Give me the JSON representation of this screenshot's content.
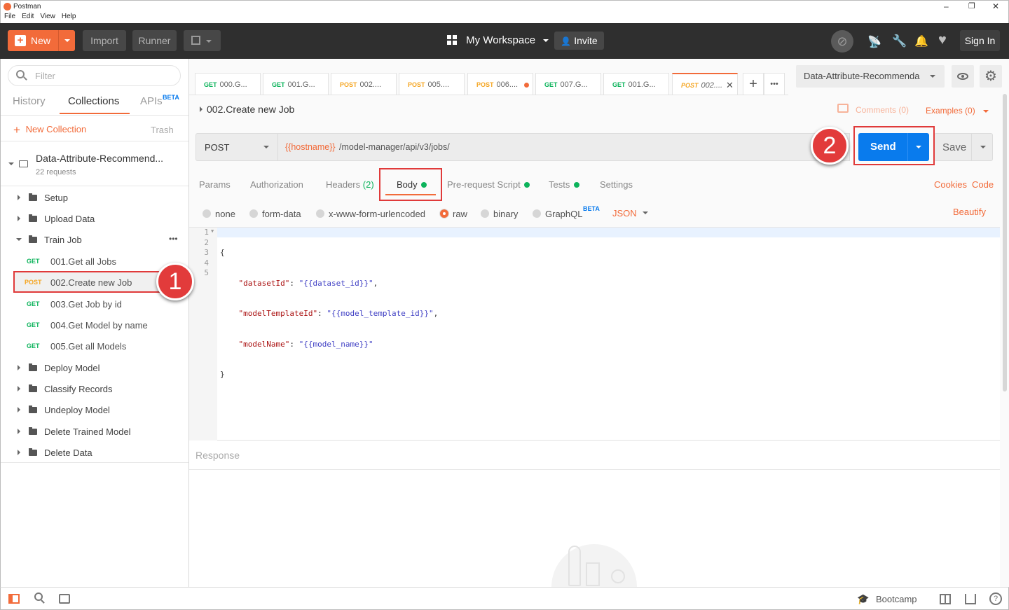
{
  "window": {
    "title": "Postman",
    "minimize": "–",
    "restore": "❐",
    "close": "✕"
  },
  "menu": [
    "File",
    "Edit",
    "View",
    "Help"
  ],
  "header": {
    "new_label": "New",
    "import_label": "Import",
    "runner_label": "Runner",
    "workspace_label": "My Workspace",
    "invite_label": "Invite",
    "signin_label": "Sign In"
  },
  "sidebar": {
    "filter_placeholder": "Filter",
    "tabs": {
      "history": "History",
      "collections": "Collections",
      "apis": "APIs",
      "apis_badge": "BETA"
    },
    "new_collection": "New Collection",
    "trash": "Trash",
    "collection": {
      "name": "Data-Attribute-Recommend...",
      "count": "22 requests"
    },
    "folders_top": [
      {
        "name": "Setup"
      },
      {
        "name": "Upload Data"
      }
    ],
    "open_folder": {
      "name": "Train Job",
      "more": "•••"
    },
    "requests": [
      {
        "method": "GET",
        "name": "001.Get all Jobs"
      },
      {
        "method": "POST",
        "name": "002.Create new Job"
      },
      {
        "method": "GET",
        "name": "003.Get Job by id"
      },
      {
        "method": "GET",
        "name": "004.Get Model by name"
      },
      {
        "method": "GET",
        "name": "005.Get all Models"
      }
    ],
    "folders_bottom": [
      {
        "name": "Deploy Model"
      },
      {
        "name": "Classify Records"
      },
      {
        "name": "Undeploy Model"
      },
      {
        "name": "Delete Trained Model"
      },
      {
        "name": "Delete Data"
      }
    ]
  },
  "tabs": [
    {
      "method": "GET",
      "name": "000.G..."
    },
    {
      "method": "GET",
      "name": "001.G..."
    },
    {
      "method": "POST",
      "name": "002...."
    },
    {
      "method": "POST",
      "name": "005...."
    },
    {
      "method": "POST",
      "name": "006...."
    },
    {
      "method": "GET",
      "name": "007.G..."
    },
    {
      "method": "GET",
      "name": "001.G..."
    },
    {
      "method": "POST",
      "name": "002...."
    }
  ],
  "tab_add": "+",
  "tab_more": "•••",
  "environment": {
    "selected": "Data-Attribute-Recommenda"
  },
  "request": {
    "breadcrumb": "002.Create new Job",
    "comments": "Comments (0)",
    "examples": "Examples (0)",
    "method": "POST",
    "url_var": "{{hostname}}",
    "url_path": "/model-manager/api/v3/jobs/",
    "send": "Send",
    "save": "Save"
  },
  "subtabs": {
    "params": "Params",
    "authorization": "Authorization",
    "headers": "Headers",
    "headers_count": "(2)",
    "body": "Body",
    "prerequest": "Pre-request Script",
    "tests": "Tests",
    "settings": "Settings",
    "cookies": "Cookies",
    "code": "Code"
  },
  "body_types": {
    "none": "none",
    "formdata": "form-data",
    "urlencoded": "x-www-form-urlencoded",
    "raw": "raw",
    "binary": "binary",
    "graphql": "GraphQL",
    "graphql_badge": "BETA",
    "format": "JSON",
    "beautify": "Beautify"
  },
  "code": {
    "line_numbers": [
      "1",
      "2",
      "3",
      "4",
      "5"
    ],
    "open_brace": "{",
    "close_brace": "}",
    "lines": [
      {
        "key": "\"datasetId\"",
        "value": "\"{{dataset_id}}\"",
        "trail": ","
      },
      {
        "key": "\"modelTemplateId\"",
        "value": "\"{{model_template_id}}\"",
        "trail": ","
      },
      {
        "key": "\"modelName\"",
        "value": "\"{{model_name}}\"",
        "trail": ""
      }
    ]
  },
  "response": {
    "label": "Response"
  },
  "footer": {
    "bootcamp": "Bootcamp"
  },
  "annotations": {
    "badge1": "1",
    "badge2": "2"
  },
  "colors": {
    "accent": "#f26b3a",
    "send": "#097bed",
    "get": "#0cb35b",
    "post": "#f5a623",
    "annotation": "#e03a3a"
  }
}
